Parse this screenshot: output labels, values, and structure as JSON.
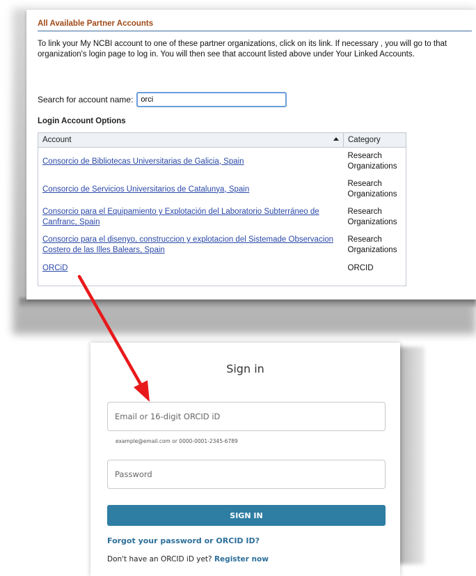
{
  "partner_accounts": {
    "title": "All Available Partner Accounts",
    "intro": "To link your My NCBI account to one of these partner organizations, click on its link. If necessary , you will go to that organization's login page to log in. You will then see that account listed above under Your Linked Accounts.",
    "search_label": "Search for account name:",
    "search_value": "orci",
    "options_title": "Login Account Options",
    "table": {
      "headers": [
        "Account",
        "Category"
      ],
      "sort_icon": "sort-ascending-icon",
      "rows": [
        {
          "account": "Consorcio de Bibliotecas Universitarias de Galicia, Spain",
          "category": "Research Organizations"
        },
        {
          "account": "Consorcio de Servicios Universitarios de Catalunya, Spain",
          "category": "Research Organizations"
        },
        {
          "account": "Consorcio para el Equipamiento y Explotación del Laboratorio Subterráneo de Canfranc, Spain",
          "category": "Research Organizations"
        },
        {
          "account": "Consorcio para el disenyo, construccion y explotacion del Sistemade Observacion Costero de las Illes Balears, Spain",
          "category": "Research Organizations"
        },
        {
          "account": "ORCiD",
          "category": "ORCID"
        }
      ]
    }
  },
  "orcid_signin": {
    "title": "Sign in",
    "email_placeholder": "Email or 16-digit ORCID iD",
    "email_hint": "example@email.com or 0000-0001-2345-6789",
    "password_placeholder": "Password",
    "sign_in_label": "SIGN IN",
    "forgot_label": "Forgot your password or ORCID ID?",
    "no_account_text": "Don't have an ORCID iD yet?",
    "register_label": "Register now"
  },
  "colors": {
    "arrow": "#e8191b",
    "section_title": "#a04a18",
    "link": "#2a48a8",
    "orcid_button": "#2e7da2",
    "orcid_link": "#2e6f9a"
  }
}
